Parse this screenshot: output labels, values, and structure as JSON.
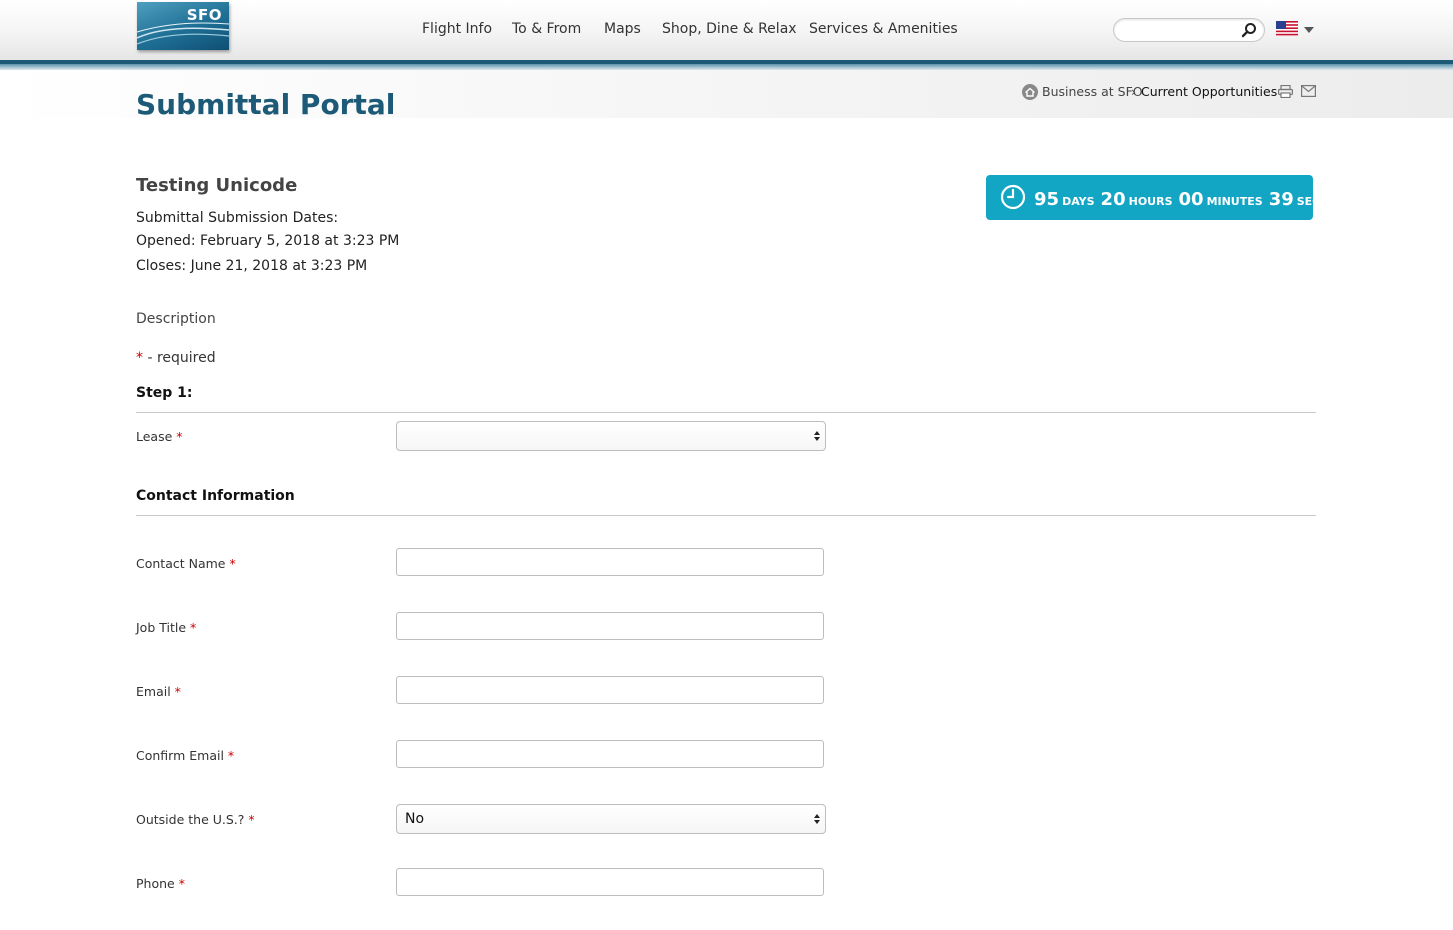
{
  "header": {
    "logo_text": "SFO",
    "nav": [
      "Flight Info",
      "To & From",
      "Maps",
      "Shop, Dine & Relax",
      "Services & Amenities"
    ],
    "search_placeholder": "",
    "language_flag": "us-flag-icon"
  },
  "page": {
    "title": "Submittal Portal",
    "breadcrumb": {
      "parent": "Business at SFO",
      "separator": "›",
      "current": "Current Opportunities"
    }
  },
  "opportunity": {
    "name": "Testing Unicode",
    "dates_label": "Submittal Submission Dates:",
    "opened": "Opened: February 5, 2018 at 3:23 PM",
    "closes": "Closes: June 21, 2018 at 3:23 PM",
    "description_label": "Description"
  },
  "countdown": {
    "days": "95",
    "days_label": "days",
    "hours": "20",
    "hours_label": "hours",
    "minutes": "00",
    "minutes_label": "minutes",
    "seconds": "39",
    "seconds_label": "seconds"
  },
  "form": {
    "required_star": "*",
    "required_note": " - required",
    "step1_heading": "Step 1:",
    "lease_label": "Lease",
    "lease_value": "",
    "contact_heading": "Contact Information",
    "fields": {
      "contact_name": "Contact Name",
      "job_title": "Job Title",
      "email": "Email",
      "confirm_email": "Confirm Email",
      "outside_us": "Outside the U.S.?",
      "phone": "Phone"
    },
    "outside_us_value": "No"
  },
  "colors": {
    "brand": "#1d5a78",
    "countdown_bg": "#12a5c4",
    "required": "#cc0000"
  }
}
